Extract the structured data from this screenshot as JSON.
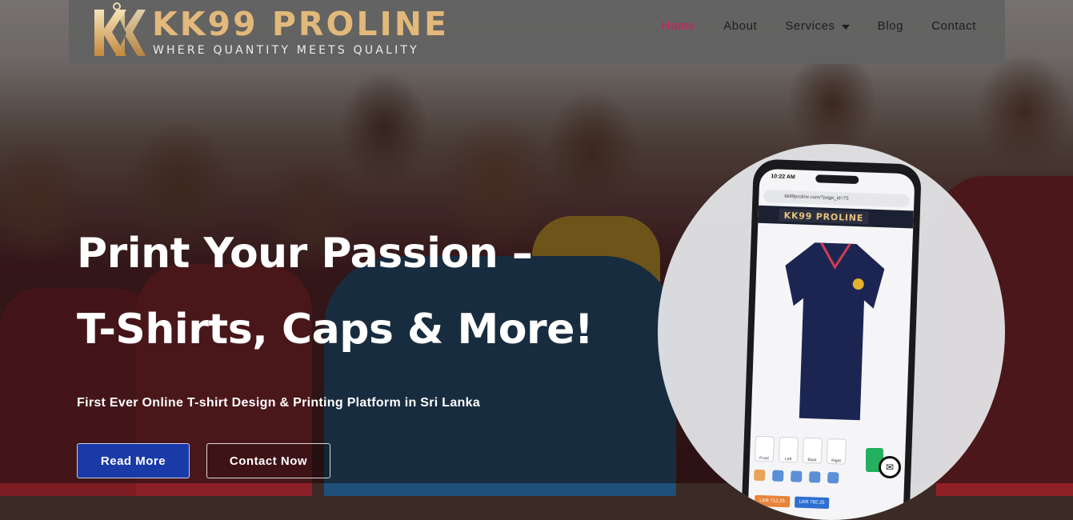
{
  "brand": {
    "name": "KK99 PROLINE",
    "tagline": "WHERE QUANTITY MEETS QUALITY",
    "colors": {
      "gold": "#e2b97a",
      "nav_active": "#d7195a",
      "primary_button": "#1a3aa8"
    }
  },
  "nav": {
    "items": [
      {
        "label": "Home",
        "active": true
      },
      {
        "label": "About",
        "active": false
      },
      {
        "label": "Services",
        "active": false,
        "has_dropdown": true
      },
      {
        "label": "Blog",
        "active": false
      },
      {
        "label": "Contact",
        "active": false
      }
    ]
  },
  "hero": {
    "headline_line1": "Print Your Passion –",
    "headline_line2": "T-Shirts, Caps & More!",
    "subheading": "First Ever Online T-shirt Design & Printing Platform in Sri Lanka",
    "buttons": {
      "read_more": "Read More",
      "contact_now": "Contact Now"
    }
  },
  "phone_mockup": {
    "status_time": "10:22 AM",
    "url": "kk99proline.com/?page_id=75",
    "app_logo": "KK99 PROLINE",
    "prices": [
      "LKR 712.25",
      "LKR 782.25"
    ]
  }
}
